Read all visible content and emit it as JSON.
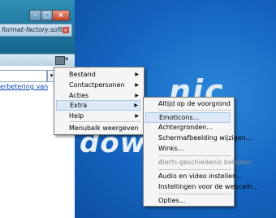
{
  "browser": {
    "tab_title": "format-factory.softoni...",
    "tab_close": "×",
    "min_glyph": "–",
    "max_glyph": "□",
    "close_glyph": "×",
    "link_text": "erbetering van"
  },
  "background": {
    "word_1": "nic",
    "word_2": "down"
  },
  "main_menu": {
    "items": [
      {
        "label": "Bestand",
        "arrow": "▶"
      },
      {
        "label": "Contactpersonen",
        "arrow": "▶"
      },
      {
        "label": "Acties",
        "arrow": "▶"
      },
      {
        "label": "Extra",
        "arrow": "▶"
      },
      {
        "label": "Help",
        "arrow": "▶"
      },
      {
        "label": "Menubalk weergeven"
      }
    ]
  },
  "sub_menu": {
    "items": [
      {
        "label": "Altijd op de voorgrond"
      },
      {
        "label": "Emoticons..."
      },
      {
        "label": "Achtergronden..."
      },
      {
        "label": "Schermafbeelding wijzigen..."
      },
      {
        "label": "Winks..."
      },
      {
        "label": "Alerts-geschiedenis bekijken"
      },
      {
        "label": "Audio en video instellen..."
      },
      {
        "label": "Instellingen voor de webcam..."
      },
      {
        "label": "Opties..."
      }
    ]
  },
  "colors": {
    "menu_highlight": "#dbe9f7",
    "background_blue": "#1565c0"
  }
}
